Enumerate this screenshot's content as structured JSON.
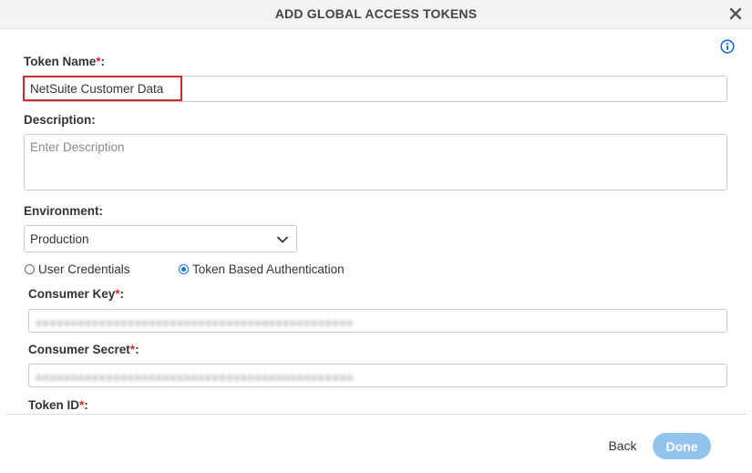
{
  "dialog": {
    "title": "ADD GLOBAL ACCESS TOKENS",
    "close_icon": "close-icon",
    "info_icon": "info-icon"
  },
  "form": {
    "token_name": {
      "label": "Token Name",
      "required_mark": "*",
      "suffix": ":",
      "value": "NetSuite Customer Data",
      "highlight_color": "#d9262b"
    },
    "description": {
      "label": "Description:",
      "placeholder": "Enter Description",
      "value": ""
    },
    "environment": {
      "label": "Environment:",
      "selected": "Production",
      "icon": "chevron-down-icon"
    },
    "auth_type": {
      "options": [
        {
          "label": "User Credentials",
          "checked": false
        },
        {
          "label": "Token Based Authentication",
          "checked": true
        }
      ]
    },
    "consumer_key": {
      "label": "Consumer Key",
      "required_mark": "*",
      "suffix": ":",
      "masked": true
    },
    "consumer_secret": {
      "label": "Consumer Secret",
      "required_mark": "*",
      "suffix": ":",
      "masked": true
    },
    "token_id": {
      "label": "Token ID",
      "required_mark": "*",
      "suffix": ":"
    }
  },
  "footer": {
    "back_label": "Back",
    "done_label": "Done",
    "done_color": "#93c4ee"
  },
  "colors": {
    "required": "#d9262b",
    "accent": "#1a73e8",
    "info_icon": "#1a6fc9"
  }
}
